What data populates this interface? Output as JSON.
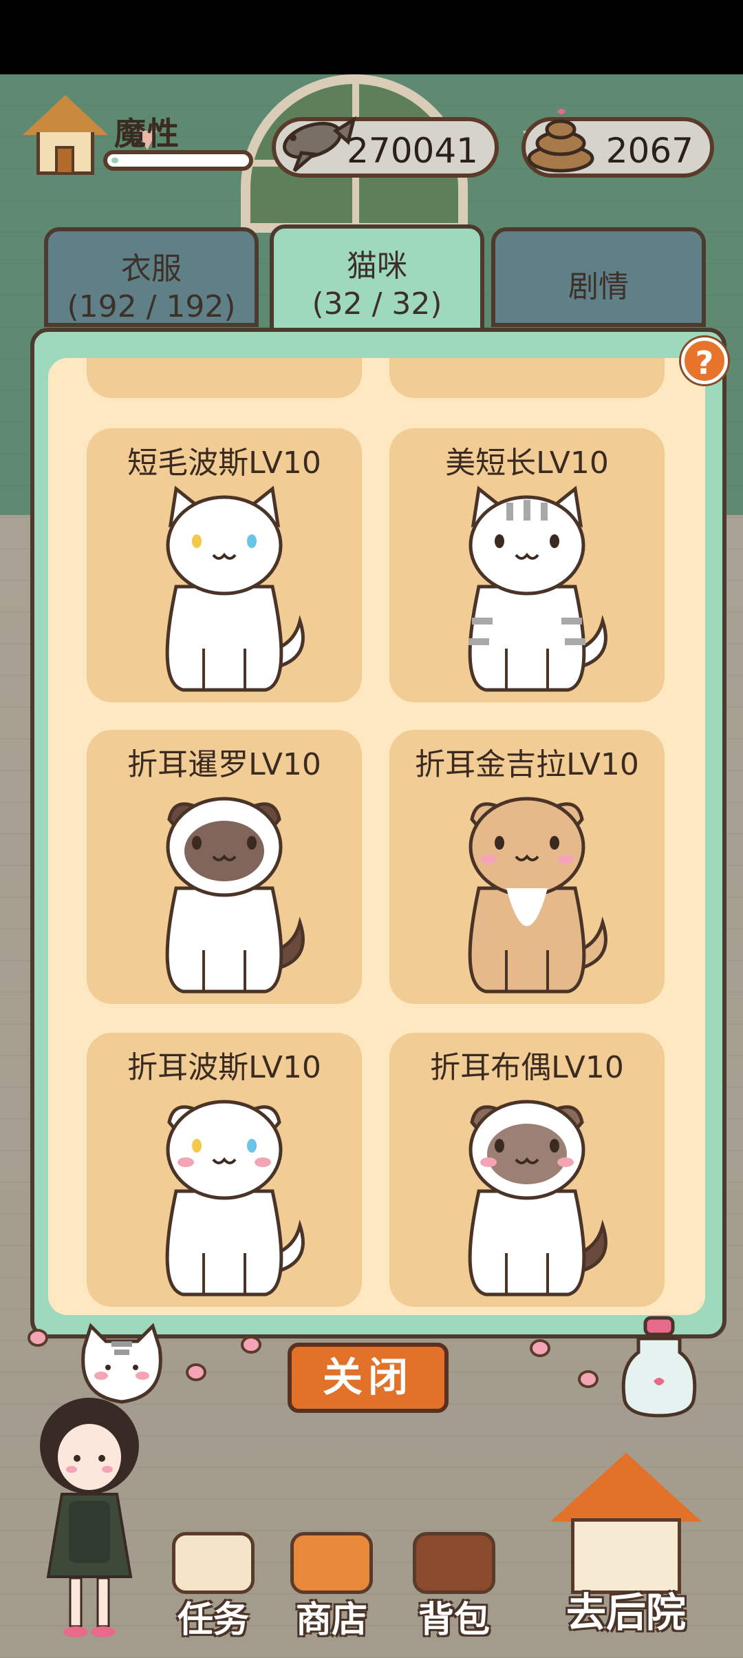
{
  "player": {
    "name": "魔性",
    "xp_fraction": 0.05
  },
  "currency": {
    "fish": "270041",
    "fish_icon": "fish-icon",
    "poop": "2067",
    "poop_icon": "poop-icon"
  },
  "tabs": [
    {
      "title": "衣服",
      "count": "(192 / 192)"
    },
    {
      "title": "猫咪",
      "count": "(32 / 32)"
    },
    {
      "title": "剧情"
    }
  ],
  "active_tab": "猫咪",
  "help_label": "?",
  "cats": [
    {
      "label": "短毛波斯LV10",
      "coat": "white",
      "eyes": [
        "#f2c94c",
        "#6cc3e8"
      ],
      "ears": "upright"
    },
    {
      "label": "美短长LV10",
      "coat": "silver-tabby",
      "ears": "upright"
    },
    {
      "label": "折耳暹罗LV10",
      "coat": "siamese",
      "ears": "folded"
    },
    {
      "label": "折耳金吉拉LV10",
      "coat": "golden",
      "ears": "folded"
    },
    {
      "label": "折耳波斯LV10",
      "coat": "white",
      "eyes": [
        "#f2c94c",
        "#6cc3e8"
      ],
      "ears": "folded"
    },
    {
      "label": "折耳布偶LV10",
      "coat": "ragdoll",
      "ears": "folded"
    }
  ],
  "close_button": "关闭",
  "nav": [
    {
      "label": "任务",
      "icon": "task-icon",
      "color": "#f4e4c8"
    },
    {
      "label": "商店",
      "icon": "shop-icon",
      "color": "#e8883a"
    },
    {
      "label": "背包",
      "icon": "backpack-icon",
      "color": "#8a4a2c"
    }
  ],
  "backyard": {
    "label": "去后院",
    "icon": "backyard-house-icon"
  },
  "colors": {
    "panel_green": "#9ed8bd",
    "panel_cream": "#fde8c2",
    "card": "#f2cc95",
    "accent_orange": "#e2722a",
    "outline": "#4d3a2e"
  }
}
